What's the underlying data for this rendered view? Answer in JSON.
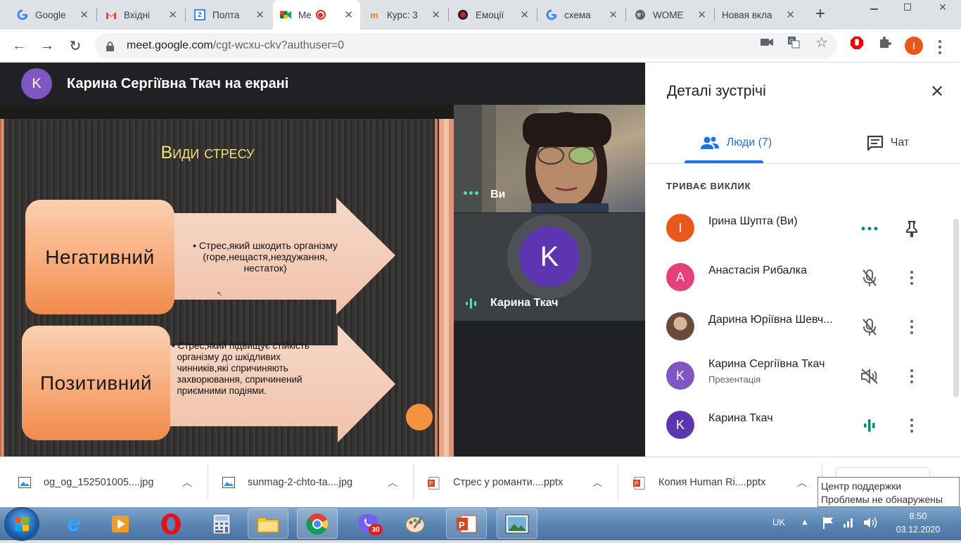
{
  "tabs": [
    {
      "title": "Google",
      "icon": "google-icon"
    },
    {
      "title": "Вхідні",
      "icon": "gmail-icon"
    },
    {
      "title": "Полта",
      "icon": "calendar-icon"
    },
    {
      "title": "Me",
      "icon": "meet-icon",
      "recording": true,
      "active": true
    },
    {
      "title": "Курс: 3",
      "icon": "moodle-icon"
    },
    {
      "title": "Емоції",
      "icon": "record-icon"
    },
    {
      "title": "схема",
      "icon": "google-icon"
    },
    {
      "title": "WOME",
      "icon": "globe-icon"
    },
    {
      "title": "Новая вкла",
      "icon": ""
    }
  ],
  "new_tab_label": "+",
  "toolbar": {
    "url_host": "meet.google.com",
    "url_path": "/cgt-wcxu-ckv?authuser=0",
    "profile_initial": "I"
  },
  "presenter": {
    "initial": "K",
    "text": "Карина Сергіївна Ткач на екрані"
  },
  "slide": {
    "title": "Види стресу",
    "items": [
      {
        "label": "Негативний",
        "text": "• Стрес,який шкодить організму\n(горе,нещастя,нездужання,\nнестаток)"
      },
      {
        "label": "Позитивний",
        "text": "• Стрес,який підвищує стійкість\n  організму до шкідливих\n  чинників,які спричиняють\n  захворювання, спричинений\n  приємними подіями."
      }
    ]
  },
  "tiles": {
    "self_label": "Ви",
    "other_initial": "K",
    "other_label": "Карина Ткач"
  },
  "sidebar": {
    "title": "Деталі зустрічі",
    "tab_people": "Люди (7)",
    "tab_chat": "Чат",
    "section": "ТРИВАЄ ВИКЛИК",
    "people": [
      {
        "initial": "I",
        "color": "#e8581d",
        "name": "Ірина Шупта (Ви)",
        "sub": "",
        "status": "more-dots",
        "action": "pin"
      },
      {
        "initial": "A",
        "color": "#e3417b",
        "name": "Анастасія Рибалка",
        "sub": "",
        "status": "mic-off",
        "action": "menu"
      },
      {
        "initial": "",
        "color": "#8a6a55",
        "name": "Дарина Юріївна Шевч...",
        "sub": "",
        "status": "mic-off",
        "action": "menu"
      },
      {
        "initial": "K",
        "color": "#7e57c2",
        "name": "Карина Сергіївна Ткач",
        "sub": "Презентація",
        "status": "volume-off",
        "action": "menu"
      },
      {
        "initial": "K",
        "color": "#5e35b1",
        "name": "Карина Ткач",
        "sub": "",
        "status": "speaking",
        "action": "menu"
      }
    ]
  },
  "downloads": [
    {
      "name": "og_og_152501005....jpg",
      "type": "image"
    },
    {
      "name": "sunmag-2-chto-ta....jpg",
      "type": "image"
    },
    {
      "name": "Стрес у романти....pptx",
      "type": "pptx"
    },
    {
      "name": "Копия Human Ri....pptx",
      "type": "pptx"
    }
  ],
  "tooltip": {
    "line1": "Центр поддержки",
    "line2": "Проблемы не обнаружены"
  },
  "taskbar": {
    "lang": "UK",
    "time": "8:50",
    "date": "03.12.2020",
    "viber_badge": "30"
  },
  "colors": {
    "accent": "#1a73e8",
    "teal": "#00897b",
    "meet_dark": "#202124"
  }
}
